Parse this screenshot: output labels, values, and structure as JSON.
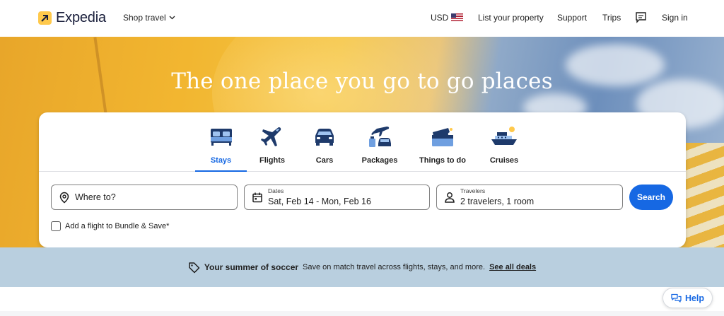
{
  "header": {
    "brand": "Expedia",
    "shop_travel": "Shop travel",
    "currency": "USD",
    "list_property": "List your property",
    "support": "Support",
    "trips": "Trips",
    "sign_in": "Sign in"
  },
  "hero": {
    "headline": "The one place you go to go places"
  },
  "tabs": [
    {
      "label": "Stays",
      "icon": "bed-icon",
      "active": true
    },
    {
      "label": "Flights",
      "icon": "plane-icon",
      "active": false
    },
    {
      "label": "Cars",
      "icon": "car-icon",
      "active": false
    },
    {
      "label": "Packages",
      "icon": "packages-icon",
      "active": false
    },
    {
      "label": "Things to do",
      "icon": "ticket-icon",
      "active": false
    },
    {
      "label": "Cruises",
      "icon": "ship-icon",
      "active": false
    }
  ],
  "search": {
    "destination_placeholder": "Where to?",
    "dates_label": "Dates",
    "dates_value": "Sat, Feb 14 - Mon, Feb 16",
    "travelers_label": "Travelers",
    "travelers_value": "2 travelers, 1 room",
    "search_button": "Search",
    "bundle_label": "Add a flight to Bundle & Save*"
  },
  "banner": {
    "title": "Your summer of soccer",
    "text": "Save on match travel across flights, stays, and more.",
    "link": "See all deals"
  },
  "help": {
    "label": "Help"
  },
  "colors": {
    "accent": "#1668e3",
    "brand_yellow": "#ffc94c",
    "banner_bg": "#b9cfdf"
  }
}
